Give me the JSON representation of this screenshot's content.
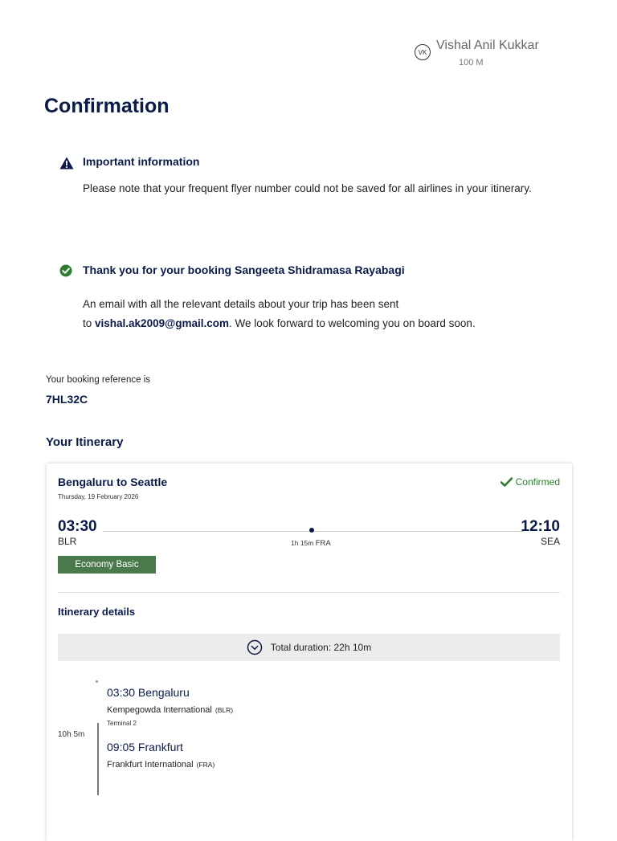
{
  "user": {
    "initials": "VK",
    "name": "Vishal Anil Kukkar",
    "points": "100 M"
  },
  "page_title": "Confirmation",
  "important": {
    "title": "Important information",
    "body": "Please note that your frequent flyer number could not be saved for all airlines in your itinerary."
  },
  "thank_you": {
    "title": "Thank you for your booking Sangeeta Shidramasa Rayabagi",
    "line1": "An email with all the relevant details about your trip has been sent",
    "line2_prefix": "to ",
    "email": "vishal.ak2009@gmail.com",
    "line2_suffix": ". We look forward to welcoming you on board soon."
  },
  "booking": {
    "label": "Your booking reference is",
    "code": "7HL32C"
  },
  "itinerary_title": "Your Itinerary",
  "flight": {
    "route": "Bengaluru to Seattle",
    "date": "Thursday, 19 February 2026",
    "status": "Confirmed",
    "departure_time": "03:30",
    "departure_code": "BLR",
    "arrival_time": "12:10",
    "arrival_code": "SEA",
    "stop_duration": "1h 15m",
    "stop_code": "FRA",
    "fare_class": "Economy Basic",
    "details_title": "Itinerary details",
    "total_duration": "Total duration: 22h 10m",
    "segment": {
      "duration": "10h 5m",
      "dep_time_city": "03:30 Bengaluru",
      "dep_airport": "Kempegowda International",
      "dep_code": "(BLR)",
      "dep_terminal": "Terminal 2",
      "arr_time_city": "09:05 Frankfurt",
      "arr_airport": "Frankfurt International",
      "arr_code": "(FRA)"
    }
  },
  "colors": {
    "navy": "#0b1b48",
    "confirmed_green": "#2e7d32",
    "fare_badge": "#4a7a4c"
  },
  "icons": {
    "warning": "warning-icon",
    "success": "check-circle-icon",
    "confirmed": "check-icon",
    "expand": "chevron-down-circle-icon"
  }
}
